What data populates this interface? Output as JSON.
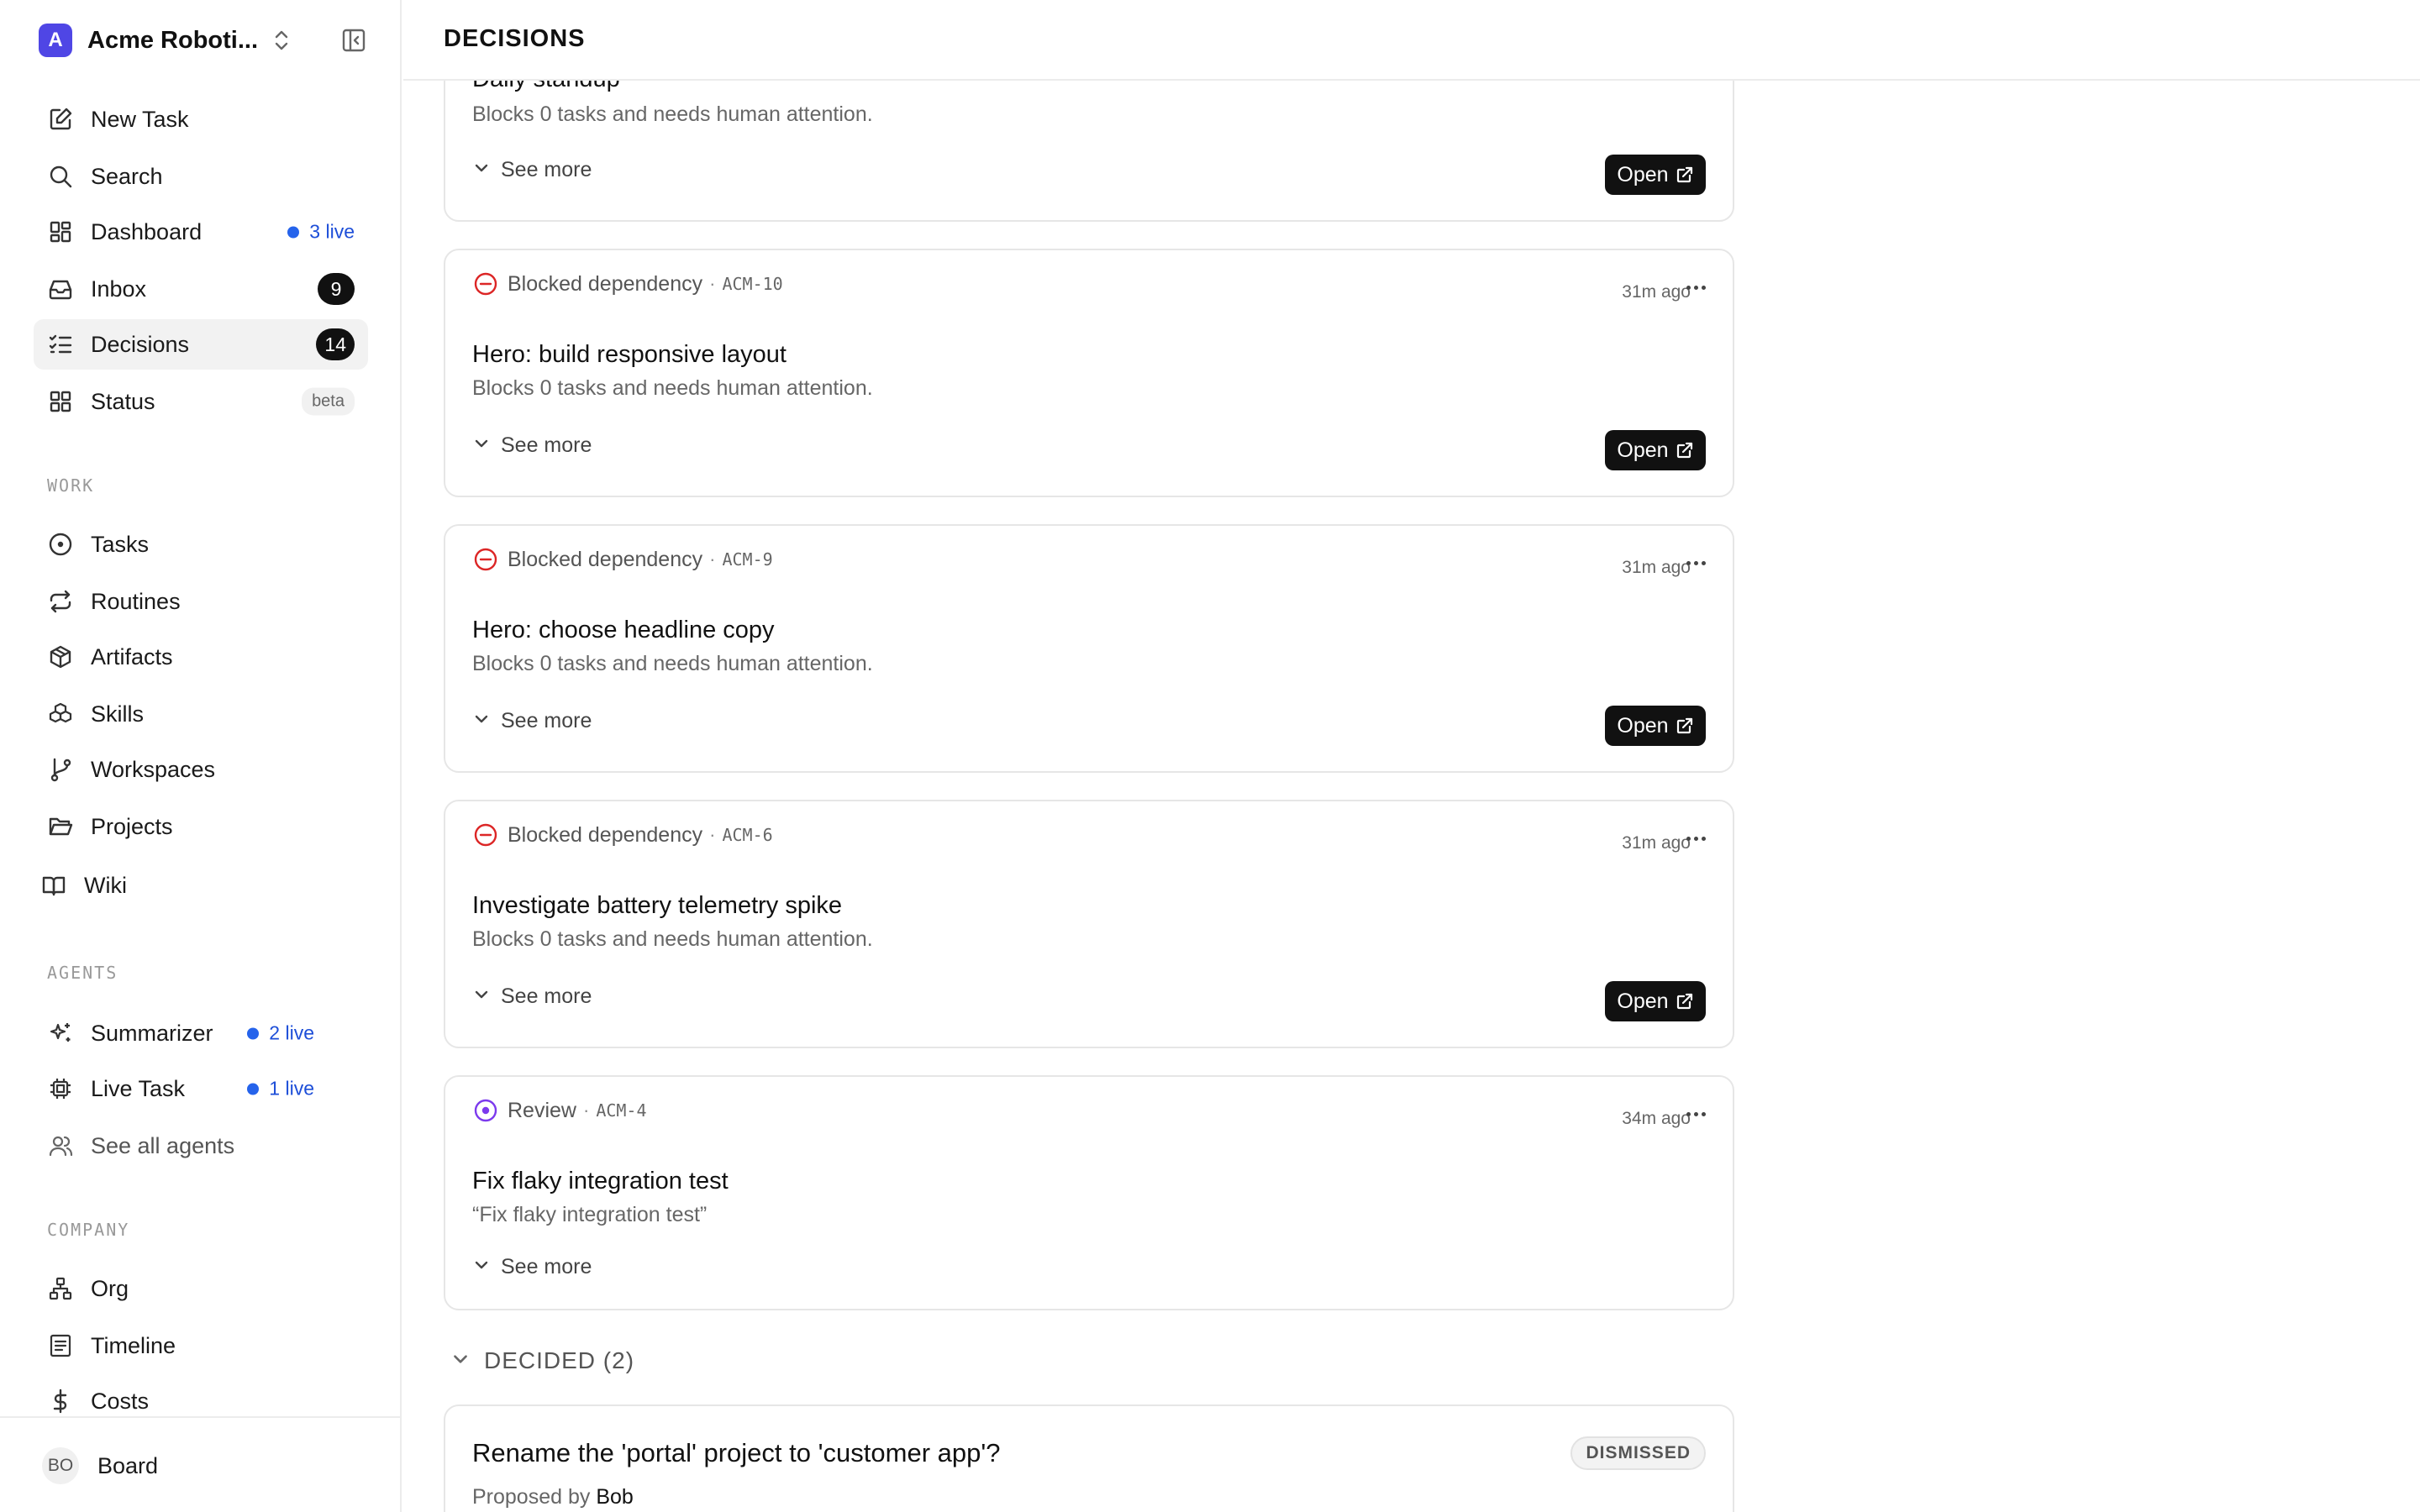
{
  "workspace": {
    "logo_letter": "A",
    "name": "Acme Roboti..."
  },
  "nav": {
    "new_task": "New Task",
    "search": "Search",
    "dashboard": "Dashboard",
    "dashboard_live": "3 live",
    "inbox": "Inbox",
    "inbox_count": "9",
    "decisions": "Decisions",
    "decisions_count": "14",
    "status": "Status",
    "status_badge": "beta"
  },
  "sections": {
    "work": "WORK",
    "agents": "AGENTS",
    "company": "COMPANY"
  },
  "work_items": {
    "tasks": "Tasks",
    "routines": "Routines",
    "artifacts": "Artifacts",
    "skills": "Skills",
    "workspaces": "Workspaces",
    "projects": "Projects",
    "wiki": "Wiki"
  },
  "agents": {
    "summarizer": "Summarizer",
    "summarizer_live": "2 live",
    "live_task": "Live Task",
    "live_task_live": "1 live",
    "see_all": "See all agents"
  },
  "company": {
    "org": "Org",
    "timeline": "Timeline",
    "costs": "Costs"
  },
  "user": {
    "initials": "BO",
    "name": "Board"
  },
  "page": {
    "title": "DECISIONS"
  },
  "cards": {
    "partial": {
      "title": "Daily standup",
      "desc": "Blocks 0 tasks and needs human attention.",
      "see_more": "See more",
      "open": "Open"
    },
    "c1": {
      "type": "Blocked dependency",
      "sep": "·",
      "id": "ACM-10",
      "time": "31m ago",
      "title": "Hero: build responsive layout",
      "desc": "Blocks 0 tasks and needs human attention.",
      "see_more": "See more",
      "open": "Open"
    },
    "c2": {
      "type": "Blocked dependency",
      "sep": "·",
      "id": "ACM-9",
      "time": "31m ago",
      "title": "Hero: choose headline copy",
      "desc": "Blocks 0 tasks and needs human attention.",
      "see_more": "See more",
      "open": "Open"
    },
    "c3": {
      "type": "Blocked dependency",
      "sep": "·",
      "id": "ACM-6",
      "time": "31m ago",
      "title": "Investigate battery telemetry spike",
      "desc": "Blocks 0 tasks and needs human attention.",
      "see_more": "See more",
      "open": "Open"
    },
    "c4": {
      "type": "Review",
      "sep": "·",
      "id": "ACM-4",
      "time": "34m ago",
      "title": "Fix flaky integration test",
      "desc": "“Fix flaky integration test”",
      "see_more": "See more"
    }
  },
  "decided": {
    "label": "DECIDED (2)",
    "item": {
      "title": "Rename the 'portal' project to 'customer app'?",
      "status": "DISMISSED",
      "proposed_prefix": "Proposed by",
      "proposed_by": "Bob"
    }
  },
  "colors": {
    "blocked": "#dc2626",
    "review": "#7c3aed",
    "live": "#2563eb",
    "accent": "#4f46e5"
  }
}
